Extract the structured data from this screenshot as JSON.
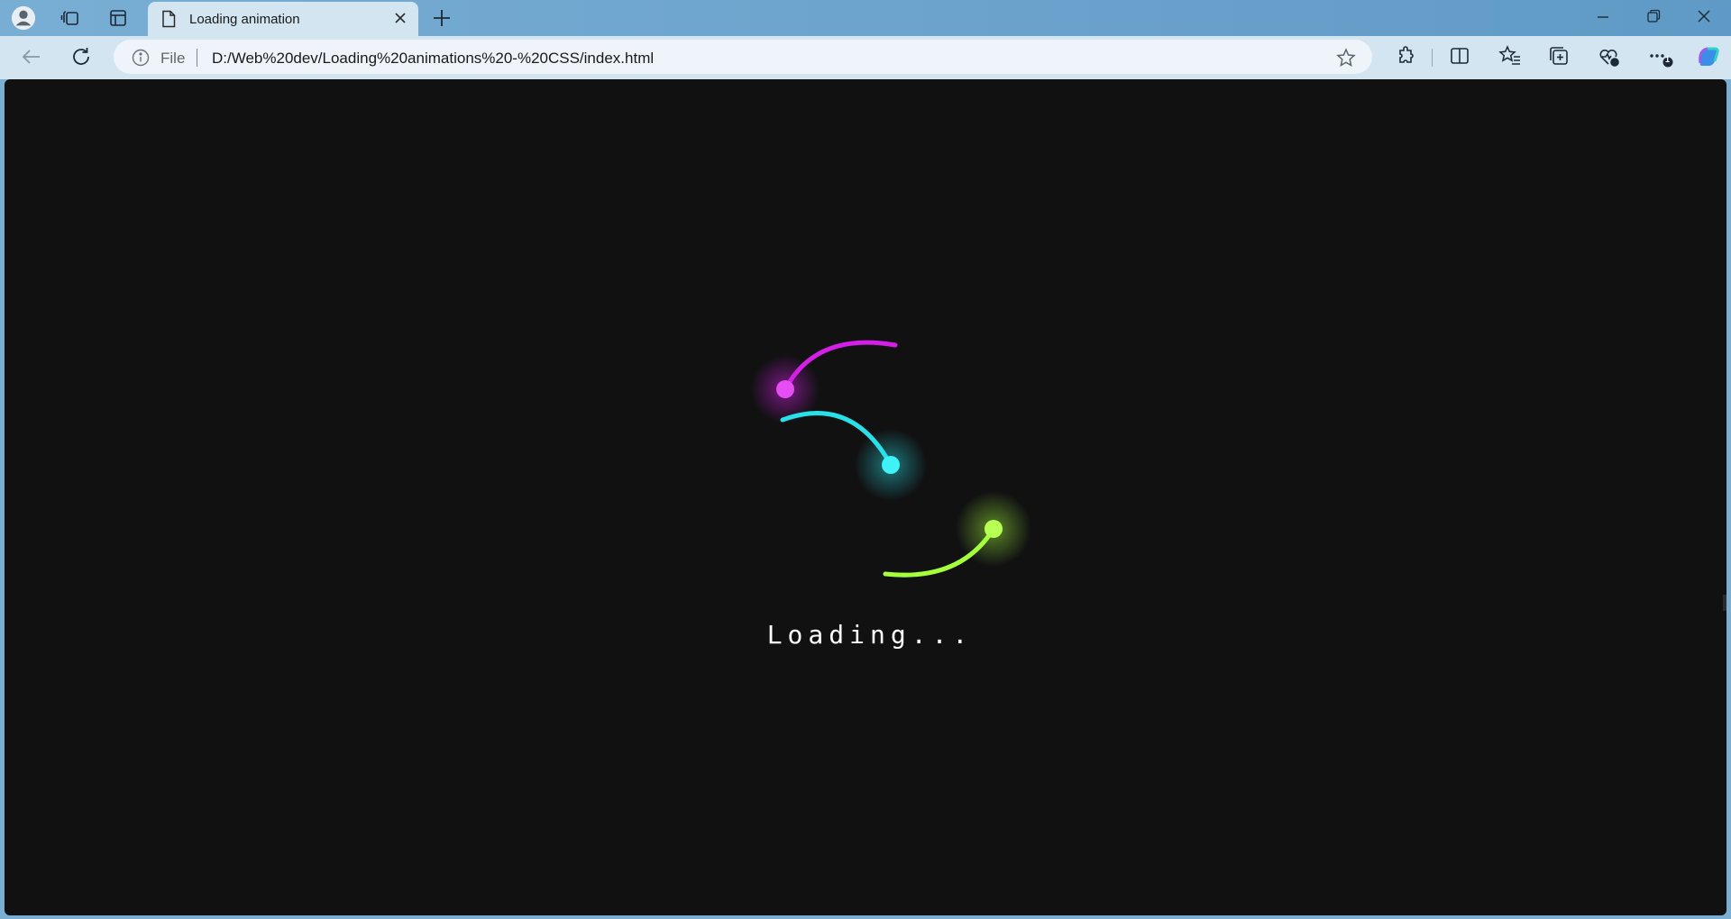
{
  "browser": {
    "tab_title": "Loading animation",
    "address_scheme": "File",
    "url": "D:/Web%20dev/Loading%20animations%20-%20CSS/index.html",
    "icons": [
      "profile-icon",
      "workspaces-icon",
      "vertical-tabs-icon",
      "page-icon",
      "close-icon",
      "new-tab-icon",
      "minimize-icon",
      "restore-icon",
      "window-close-icon",
      "back-icon",
      "refresh-icon",
      "info-icon",
      "favorite-star-icon",
      "extensions-icon",
      "split-screen-icon",
      "favorites-icon",
      "collections-icon",
      "browser-essentials-icon",
      "more-icon",
      "copilot-icon"
    ],
    "notification_badge": "1"
  },
  "page": {
    "loading_text": "Loading...",
    "colors": {
      "background": "#111112",
      "magenta": "#d41fe6",
      "cyan": "#2ae0e8",
      "green": "#a6ff3c"
    }
  }
}
